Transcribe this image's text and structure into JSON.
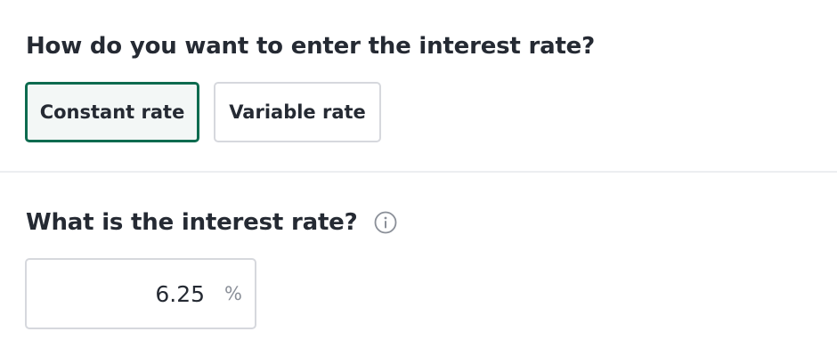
{
  "rate_type": {
    "question": "How do you want to enter the interest rate?",
    "options": [
      {
        "label": "Constant rate",
        "selected": true
      },
      {
        "label": "Variable rate",
        "selected": false
      }
    ]
  },
  "interest_rate": {
    "question": "What is the interest rate?",
    "info_icon": "info-circle-icon",
    "value": "6.25",
    "unit": "%"
  },
  "colors": {
    "selected_border": "#0d6b4f",
    "selected_background": "#f3f7f6",
    "border": "#d6d8dd",
    "text": "#252a33",
    "muted": "#8a8f98"
  }
}
